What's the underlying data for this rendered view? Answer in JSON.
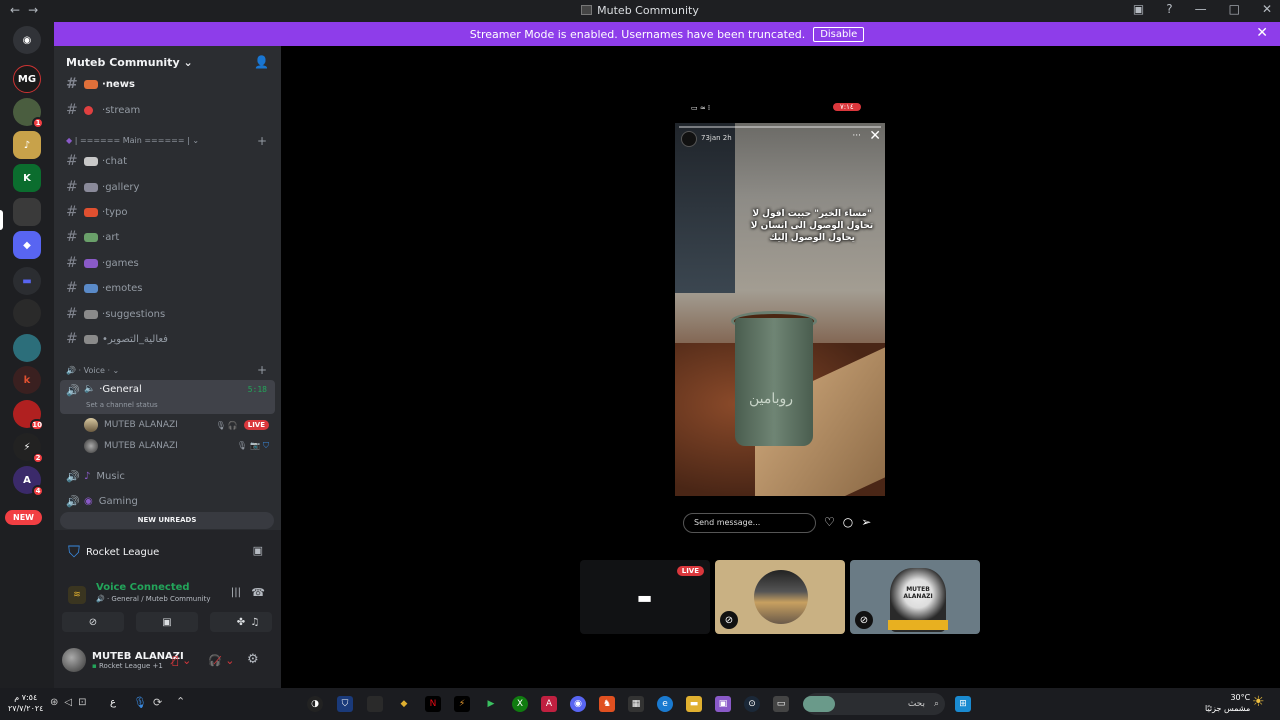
{
  "window": {
    "title": "Muteb Community",
    "nav_back": "←",
    "nav_forward": "→",
    "controls": [
      "▣",
      "?",
      "—",
      "□",
      "✕"
    ]
  },
  "banner": {
    "text": "Streamer Mode is enabled. Usernames have been truncated.",
    "button": "Disable",
    "close": "✕"
  },
  "servers": {
    "home": "◉",
    "items": [
      {
        "label": "MG",
        "color": "#1a1a1a",
        "badge": ""
      },
      {
        "label": "",
        "color": "#4a5d3f",
        "badge": "1"
      },
      {
        "label": "♪",
        "color": "#c8a24a",
        "badge": ""
      },
      {
        "label": "K",
        "color": "#0b6d2e",
        "badge": ""
      },
      {
        "label": "",
        "color": "#3a3a3a",
        "badge": ""
      },
      {
        "label": "◆",
        "color": "#5865f2",
        "badge": ""
      },
      {
        "label": "▬",
        "color": "#5865f2",
        "badge": ""
      },
      {
        "label": "",
        "color": "#2a2a2a",
        "badge": ""
      },
      {
        "label": "",
        "color": "#2c6e7a",
        "badge": ""
      },
      {
        "label": "k",
        "color": "#3a2020",
        "badge": ""
      },
      {
        "label": "",
        "color": "#b02020",
        "badge": "10"
      },
      {
        "label": "⚡",
        "color": "#222",
        "badge": "2"
      },
      {
        "label": "A",
        "color": "#3b2a6a",
        "badge": "4"
      }
    ],
    "new_pill": "NEW"
  },
  "sidebar": {
    "guild_name": "Muteb Community",
    "channels_top": [
      {
        "name": "news",
        "emoji_color": "#e0703a",
        "bold": true
      },
      {
        "name": "stream",
        "emoji_color": "#e04040",
        "bold": false
      }
    ],
    "main_category": "| ====== Main ====== |",
    "channels_main": [
      {
        "name": "chat",
        "emoji_color": "#c8c8c8"
      },
      {
        "name": "gallery",
        "emoji_color": "#8a8a9a"
      },
      {
        "name": "typo",
        "emoji_color": "#e05030"
      },
      {
        "name": "art",
        "emoji_color": "#6aa06a"
      },
      {
        "name": "games",
        "emoji_color": "#8a5ac8"
      },
      {
        "name": "emotes",
        "emoji_color": "#5a8ac8"
      },
      {
        "name": "suggestions",
        "emoji_color": "#8a8a8a"
      },
      {
        "name": "•فعالية_التصوير",
        "emoji_color": "#8a8a8a"
      }
    ],
    "voice_category": "Voice",
    "voice_general": {
      "name": "General",
      "timer": "5:18",
      "status_hint": "Set a channel status"
    },
    "voice_users": [
      {
        "name": "MUTEB ALANAZI",
        "live": "LIVE"
      },
      {
        "name": "MUTEB ALANAZI",
        "live": ""
      }
    ],
    "voice_channels": [
      {
        "name": "Music"
      },
      {
        "name": "Gaming"
      }
    ],
    "new_unreads": "NEW UNREADS"
  },
  "panel": {
    "activity": "Rocket League",
    "voice_connected": "Voice Connected",
    "voice_location": "General / Muteb Community",
    "user_name": "MUTEB ALANAZI",
    "user_status": "Rocket League +1"
  },
  "stage": {
    "story_time": "٧:١٤",
    "story_author": "73jan  2h",
    "story_quote": "\"مساء الخير\" حبيت اقول لا تحاول الوصول الى انسان لا يحاول الوصول إليك",
    "cup_text": "روبامين",
    "send_placeholder": "Send message...",
    "tiles": [
      {
        "type": "stream",
        "live": "LIVE"
      },
      {
        "type": "user"
      },
      {
        "type": "user",
        "label": "MUTEB ALANAZI"
      }
    ]
  },
  "taskbar": {
    "time": "٧:٥٤ م",
    "date": "٢٧/٧/٢٠٢٤",
    "input_lang": "ع",
    "search_placeholder": "بحث",
    "weather_temp": "30°C",
    "weather_desc": "مشمس جزئيًا"
  }
}
